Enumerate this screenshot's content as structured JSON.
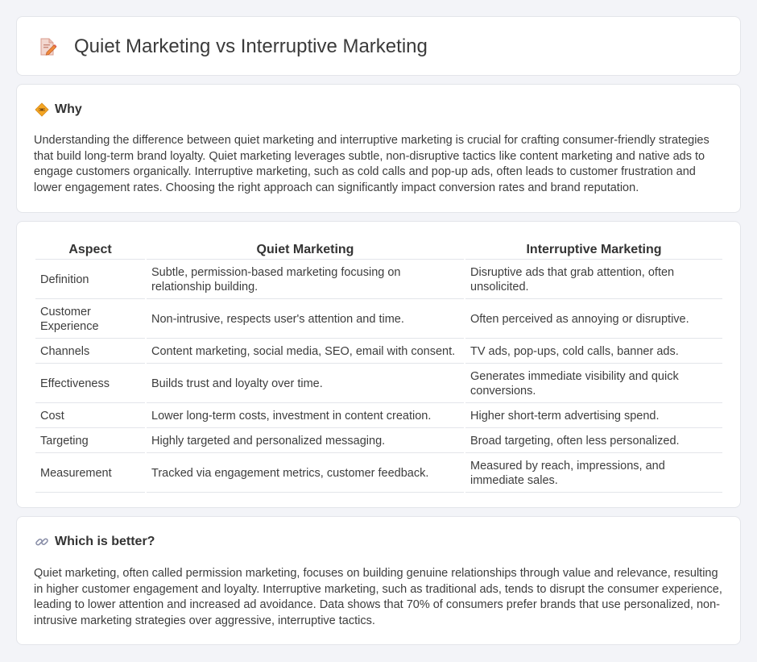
{
  "page": {
    "title": "Quiet Marketing vs Interruptive Marketing",
    "title_icon": "document-pencil-icon"
  },
  "why": {
    "icon": "diamond-sign-icon",
    "heading": "Why",
    "body": "Understanding the difference between quiet marketing and interruptive marketing is crucial for crafting consumer-friendly strategies that build long-term brand loyalty. Quiet marketing leverages subtle, non-disruptive tactics like content marketing and native ads to engage customers organically. Interruptive marketing, such as cold calls and pop-up ads, often leads to customer frustration and lower engagement rates. Choosing the right approach can significantly impact conversion rates and brand reputation."
  },
  "comparison": {
    "headers": [
      "Aspect",
      "Quiet Marketing",
      "Interruptive Marketing"
    ],
    "rows": [
      {
        "aspect": "Definition",
        "quiet": "Subtle, permission-based marketing focusing on relationship building.",
        "interruptive": "Disruptive ads that grab attention, often unsolicited."
      },
      {
        "aspect": "Customer Experience",
        "quiet": "Non-intrusive, respects user's attention and time.",
        "interruptive": "Often perceived as annoying or disruptive."
      },
      {
        "aspect": "Channels",
        "quiet": "Content marketing, social media, SEO, email with consent.",
        "interruptive": "TV ads, pop-ups, cold calls, banner ads."
      },
      {
        "aspect": "Effectiveness",
        "quiet": "Builds trust and loyalty over time.",
        "interruptive": "Generates immediate visibility and quick conversions."
      },
      {
        "aspect": "Cost",
        "quiet": "Lower long-term costs, investment in content creation.",
        "interruptive": "Higher short-term advertising spend."
      },
      {
        "aspect": "Targeting",
        "quiet": "Highly targeted and personalized messaging.",
        "interruptive": "Broad targeting, often less personalized."
      },
      {
        "aspect": "Measurement",
        "quiet": "Tracked via engagement metrics, customer feedback.",
        "interruptive": "Measured by reach, impressions, and immediate sales."
      }
    ]
  },
  "better": {
    "icon": "link-icon",
    "heading": "Which is better?",
    "body": "Quiet marketing, often called permission marketing, focuses on building genuine relationships through value and relevance, resulting in higher customer engagement and loyalty. Interruptive marketing, such as traditional ads, tends to disrupt the consumer experience, leading to lower attention and increased ad avoidance. Data shows that 70% of consumers prefer brands that use personalized, non-intrusive marketing strategies over aggressive, interruptive tactics."
  }
}
